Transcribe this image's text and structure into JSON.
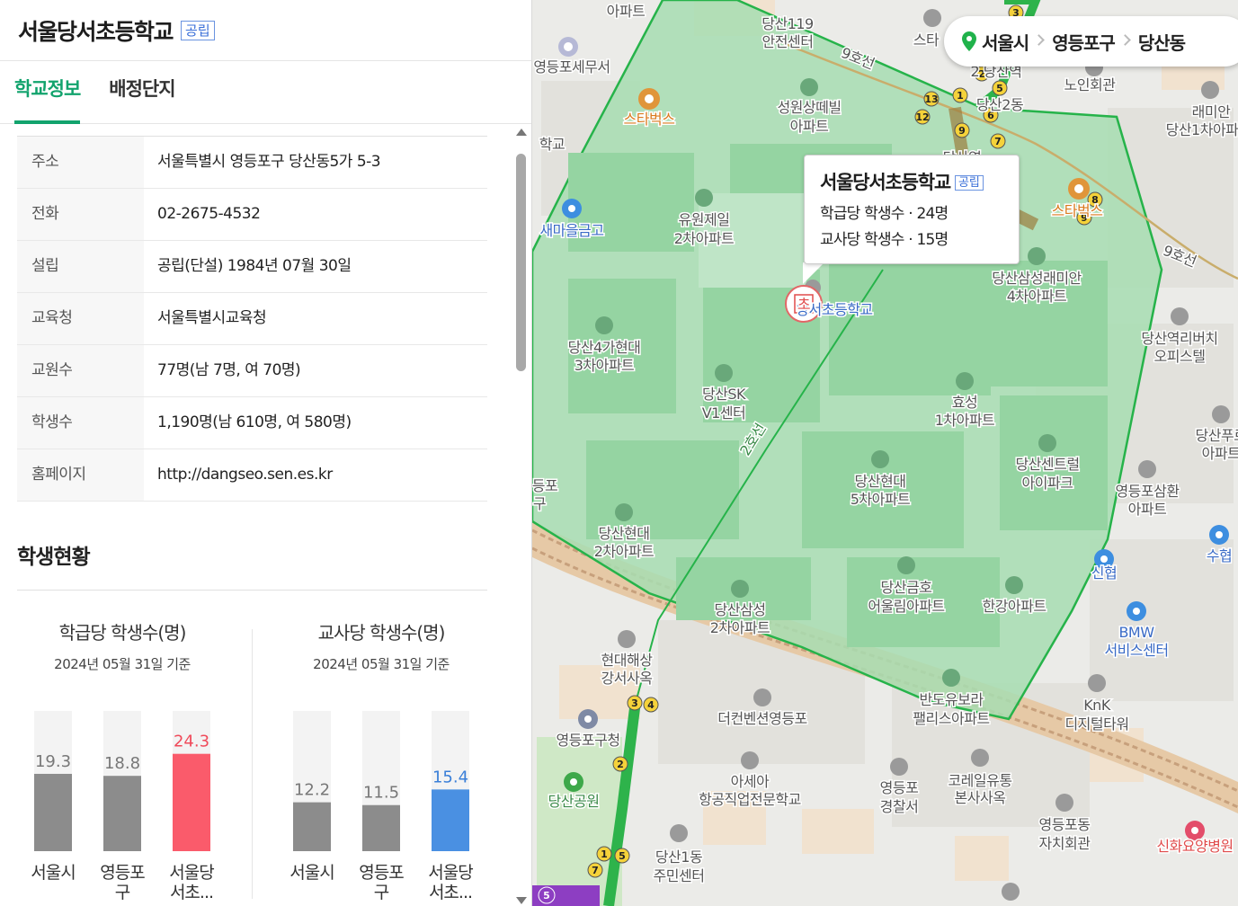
{
  "school": {
    "name": "서울당서초등학교",
    "type_badge": "공립"
  },
  "tabs": [
    {
      "label": "학교정보",
      "active": true
    },
    {
      "label": "배정단지",
      "active": false
    }
  ],
  "info": [
    {
      "key": "주소",
      "value": "서울특별시 영등포구 당산동5가 5-3"
    },
    {
      "key": "전화",
      "value": "02-2675-4532"
    },
    {
      "key": "설립",
      "value": "공립(단설) 1984년 07월 30일"
    },
    {
      "key": "교육청",
      "value": "서울특별시교육청"
    },
    {
      "key": "교원수",
      "value": "77명(남 7명, 여 70명)"
    },
    {
      "key": "학생수",
      "value": "1,190명(남 610명, 여 580명)"
    },
    {
      "key": "홈페이지",
      "value": "http://dangseo.sen.es.kr"
    }
  ],
  "student_section": {
    "title": "학생현황"
  },
  "chart_data": [
    {
      "type": "bar",
      "title": "학급당 학생수(명)",
      "subtitle": "2024년 05월 31일 기준",
      "categories": [
        "서울시",
        "영등포\n구",
        "서울당\n서초..."
      ],
      "values": [
        19.3,
        18.8,
        24.3
      ],
      "colors": [
        "#8c8c8c",
        "#8c8c8c",
        "#fa5b6b"
      ],
      "label_colors": [
        "#777777",
        "#777777",
        "#f04a5a"
      ],
      "ylim": [
        0,
        35
      ]
    },
    {
      "type": "bar",
      "title": "교사당 학생수(명)",
      "subtitle": "2024년 05월 31일 기준",
      "categories": [
        "서울시",
        "영등포\n구",
        "서울당\n서초..."
      ],
      "values": [
        12.2,
        11.5,
        15.4
      ],
      "colors": [
        "#8c8c8c",
        "#8c8c8c",
        "#4a90e2"
      ],
      "label_colors": [
        "#777777",
        "#777777",
        "#3a7fd8"
      ],
      "ylim": [
        0,
        35
      ]
    }
  ],
  "breadcrumb": [
    "서울시",
    "영등포구",
    "당산동"
  ],
  "popup": {
    "title": "서울당서초등학교",
    "badge": "공립",
    "line1": "학급당 학생수 · 24명",
    "line2": "교사당 학생수 · 15명"
  },
  "map_labels": [
    {
      "text": "아파트",
      "color": "gray"
    },
    {
      "text": "당산119",
      "color": "gray"
    },
    {
      "text": "안전센터",
      "color": "gray"
    },
    {
      "text": "스타",
      "color": "gray"
    },
    {
      "text": "영등포세무서",
      "color": "gray"
    },
    {
      "text": "스타벅스",
      "color": "orange"
    },
    {
      "text": "성원상떼빌",
      "color": "gray"
    },
    {
      "text": "아파트",
      "color": "gray"
    },
    {
      "text": "2 당산역",
      "color": "gray"
    },
    {
      "text": "당산2동",
      "color": "gray"
    },
    {
      "text": "노인회관",
      "color": "gray"
    },
    {
      "text": "래미안",
      "color": "gray"
    },
    {
      "text": "당산1차아파",
      "color": "gray"
    },
    {
      "text": "학교",
      "color": "gray"
    },
    {
      "text": "새마을금고",
      "color": "blue"
    },
    {
      "text": "유원제일",
      "color": "gray"
    },
    {
      "text": "2차아파트",
      "color": "gray"
    },
    {
      "text": "스타벅스",
      "color": "orange"
    },
    {
      "text": "당산삼성래미안",
      "color": "gray"
    },
    {
      "text": "4차아파트",
      "color": "gray"
    },
    {
      "text": "당서초등학교",
      "color": "blue"
    },
    {
      "text": "당산4가현대",
      "color": "gray"
    },
    {
      "text": "3차아파트",
      "color": "gray"
    },
    {
      "text": "당산SK",
      "color": "gray"
    },
    {
      "text": "V1센터",
      "color": "gray"
    },
    {
      "text": "당산역리버치",
      "color": "gray"
    },
    {
      "text": "오피스텔",
      "color": "gray"
    },
    {
      "text": "효성",
      "color": "gray"
    },
    {
      "text": "1차아파트",
      "color": "gray"
    },
    {
      "text": "당산푸르",
      "color": "gray"
    },
    {
      "text": "아파트",
      "color": "gray"
    },
    {
      "text": "당산현대",
      "color": "gray"
    },
    {
      "text": "5차아파트",
      "color": "gray"
    },
    {
      "text": "당산센트럴",
      "color": "gray"
    },
    {
      "text": "아이파크",
      "color": "gray"
    },
    {
      "text": "영등포삼환",
      "color": "gray"
    },
    {
      "text": "아파트",
      "color": "gray"
    },
    {
      "text": "당산현대",
      "color": "gray"
    },
    {
      "text": "2차아파트",
      "color": "gray"
    },
    {
      "text": "신협",
      "color": "blue"
    },
    {
      "text": "수협",
      "color": "blue"
    },
    {
      "text": "당산금호",
      "color": "gray"
    },
    {
      "text": "어울림아파트",
      "color": "gray"
    },
    {
      "text": "한강아파트",
      "color": "gray"
    },
    {
      "text": "당산삼성",
      "color": "gray"
    },
    {
      "text": "2차아파트",
      "color": "gray"
    },
    {
      "text": "BMW",
      "color": "blue"
    },
    {
      "text": "서비스센터",
      "color": "blue"
    },
    {
      "text": "현대해상",
      "color": "gray"
    },
    {
      "text": "강서사옥",
      "color": "gray"
    },
    {
      "text": "반도유보라",
      "color": "gray"
    },
    {
      "text": "팰리스아파트",
      "color": "gray"
    },
    {
      "text": "KnK",
      "color": "gray"
    },
    {
      "text": "디지털타워",
      "color": "gray"
    },
    {
      "text": "더컨벤션영등포",
      "color": "gray"
    },
    {
      "text": "영등포구청",
      "color": "gray"
    },
    {
      "text": "아세아",
      "color": "gray"
    },
    {
      "text": "항공직업전문학교",
      "color": "gray"
    },
    {
      "text": "영등포",
      "color": "gray"
    },
    {
      "text": "경찰서",
      "color": "gray"
    },
    {
      "text": "코레일유통",
      "color": "gray"
    },
    {
      "text": "본사사옥",
      "color": "gray"
    },
    {
      "text": "당산공원",
      "color": "green"
    },
    {
      "text": "영등포동",
      "color": "gray"
    },
    {
      "text": "자치회관",
      "color": "gray"
    },
    {
      "text": "신화요양병원",
      "color": "red"
    },
    {
      "text": "당산1동",
      "color": "gray"
    },
    {
      "text": "주민센터",
      "color": "gray"
    },
    {
      "text": "9호선",
      "color": "gray"
    },
    {
      "text": "9호선",
      "color": "gray"
    },
    {
      "text": "2호선",
      "color": "green"
    },
    {
      "text": "당산역",
      "color": "gray"
    },
    {
      "text": "등포",
      "color": "gray"
    },
    {
      "text": "구",
      "color": "gray"
    },
    {
      "text": "초",
      "color": "red"
    }
  ]
}
